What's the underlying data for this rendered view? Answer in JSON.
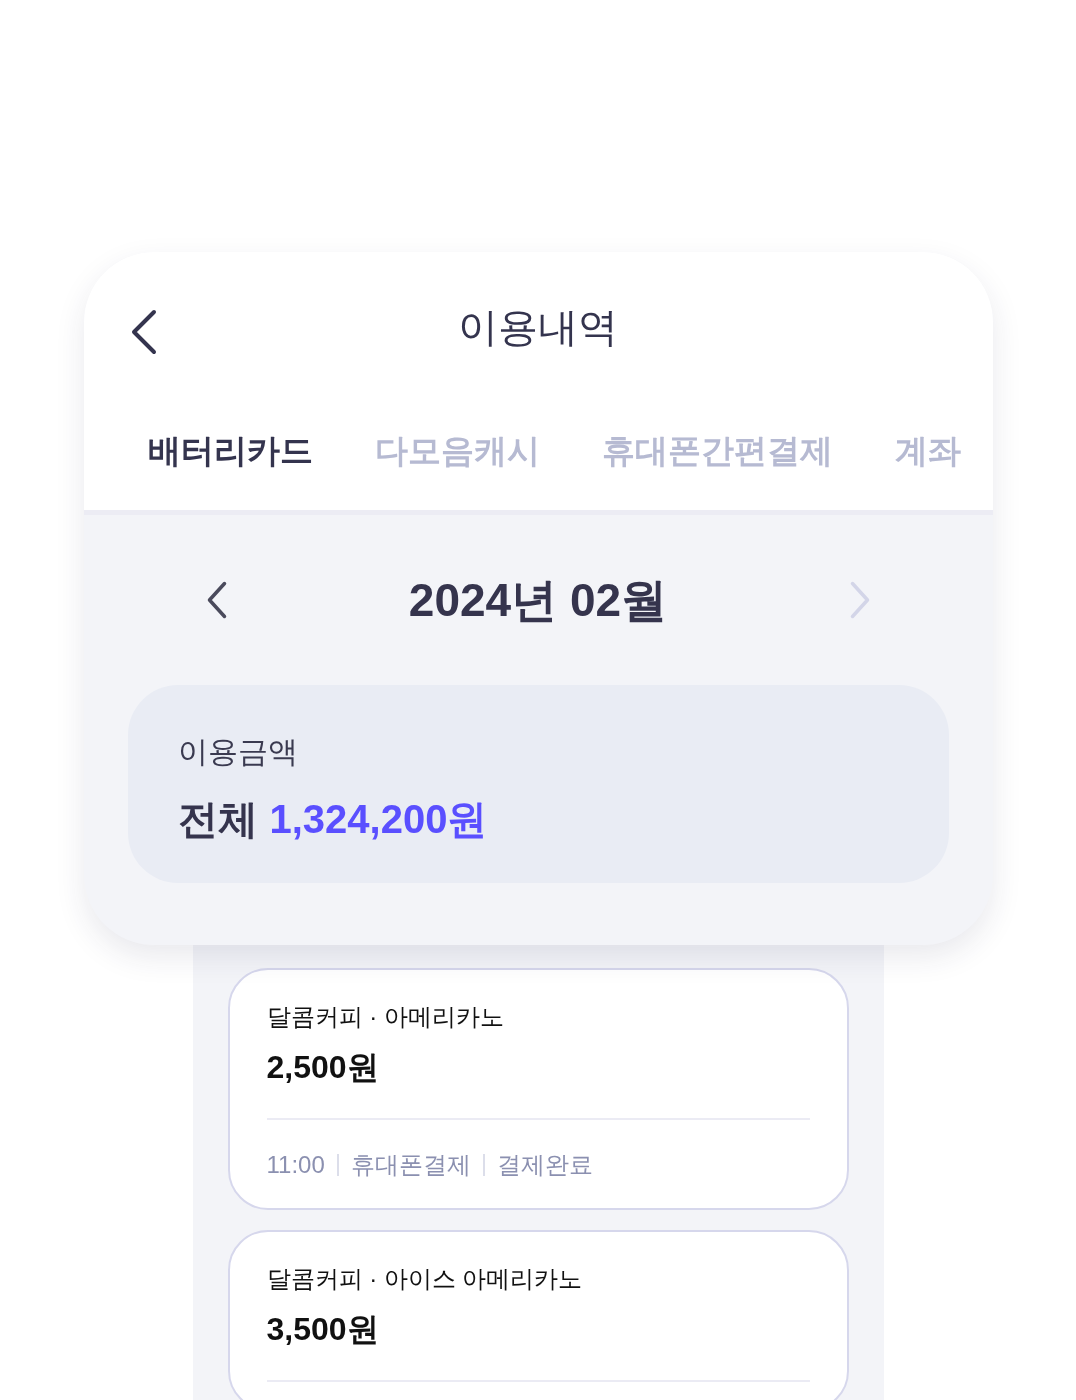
{
  "header": {
    "title": "이용내역"
  },
  "tabs": [
    {
      "label": "배터리카드",
      "selected": true
    },
    {
      "label": "다모음캐시",
      "selected": false
    },
    {
      "label": "휴대폰간편결제",
      "selected": false
    },
    {
      "label": "계좌",
      "selected": false
    }
  ],
  "month_nav": {
    "label": "2024년 02월",
    "prev": {
      "disabled": false
    },
    "next": {
      "disabled": true
    }
  },
  "summary": {
    "title": "이용금액",
    "prefix": "전체",
    "amount": "1,324,200원"
  },
  "transactions": [
    {
      "title": "달콤커피 · 아메리카노",
      "amount": "2,500원",
      "time": "11:00",
      "method": "휴대폰결제",
      "status": "결제완료"
    },
    {
      "title": "달콤커피 · 아이스 아메리카노",
      "amount": "3,500원"
    }
  ]
}
